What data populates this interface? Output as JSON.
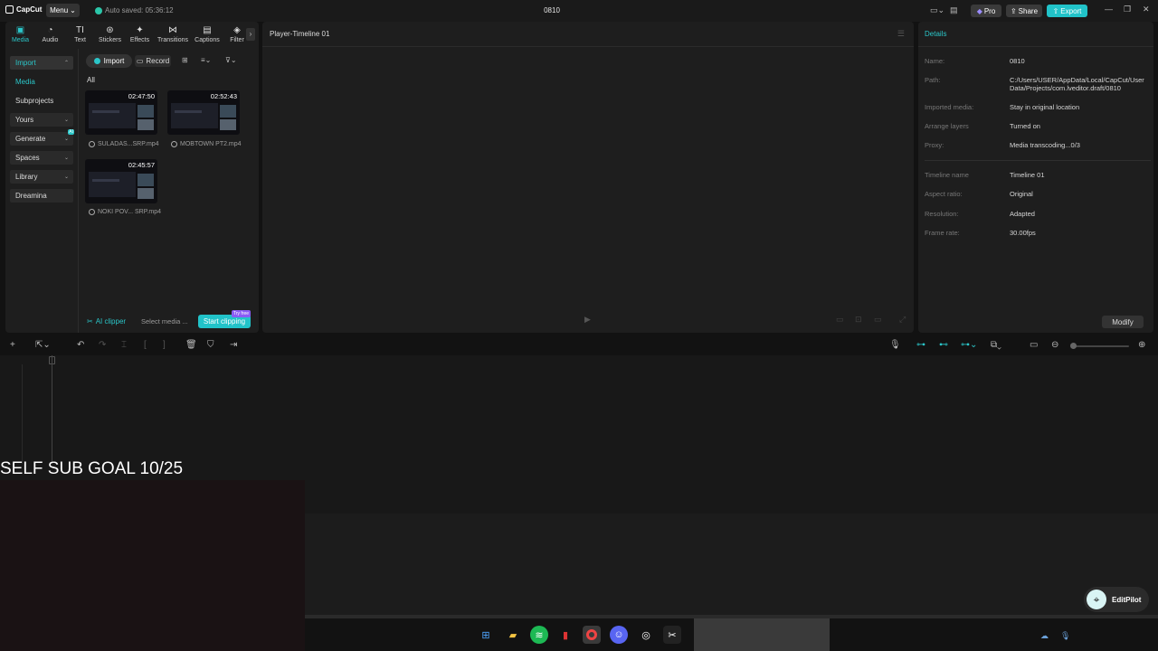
{
  "app": {
    "logo": "CapCut",
    "menu_label": "Menu",
    "autosave": "Auto saved: 05:36:12",
    "project_title": "0810",
    "pro_label": "Pro",
    "share_label": "Share",
    "export_label": "Export"
  },
  "tabs": [
    {
      "label": "Media",
      "icon": "media-icon",
      "glyph": "▣"
    },
    {
      "label": "Audio",
      "icon": "audio-icon",
      "glyph": "◔"
    },
    {
      "label": "Text",
      "icon": "text-icon",
      "glyph": "TI"
    },
    {
      "label": "Stickers",
      "icon": "stickers-icon",
      "glyph": "⊛"
    },
    {
      "label": "Effects",
      "icon": "effects-icon",
      "glyph": "✦"
    },
    {
      "label": "Transitions",
      "icon": "transitions-icon",
      "glyph": "⋈"
    },
    {
      "label": "Captions",
      "icon": "captions-icon",
      "glyph": "▤"
    },
    {
      "label": "Filter",
      "icon": "filter-icon",
      "glyph": "◈"
    }
  ],
  "sidenav": {
    "import": "Import",
    "media": "Media",
    "subprojects": "Subprojects",
    "yours": "Yours",
    "generate": "Generate",
    "generate_badge": "AI",
    "spaces": "Spaces",
    "library": "Library",
    "dreamina": "Dreamina"
  },
  "media": {
    "import_label": "Import",
    "record_label": "Record",
    "all_label": "All",
    "items": [
      {
        "duration": "02:47:50",
        "name": "SULADAS...SRP.mp4"
      },
      {
        "duration": "02:52:43",
        "name": "MOBTOWN PT2.mp4"
      },
      {
        "duration": "02:45:57",
        "name": "NOKI POV... SRP.mp4"
      }
    ]
  },
  "clipper": {
    "label": "AI clipper",
    "select_text": "Select media ...",
    "start_label": "Start clipping",
    "badge": "Try free"
  },
  "player": {
    "title": "Player-Timeline 01"
  },
  "details": {
    "title": "Details",
    "rows": [
      {
        "key": "Name:",
        "value": "0810"
      },
      {
        "key": "Path:",
        "value": "C:/Users/USER/AppData/Local/CapCut/User Data/Projects/com.lveditor.draft/0810"
      },
      {
        "key": "Imported media:",
        "value": "Stay in original location"
      },
      {
        "key": "Arrange layers",
        "value": "Turned on"
      },
      {
        "key": "Proxy:",
        "value": "Media transcoding...0/3"
      },
      {
        "key": "Timeline name",
        "value": "Timeline 01"
      },
      {
        "key": "Aspect ratio:",
        "value": "Original"
      },
      {
        "key": "Resolution:",
        "value": "Adapted"
      },
      {
        "key": "Frame rate:",
        "value": "30.00fps"
      }
    ],
    "modify_label": "Modify"
  },
  "overlay": {
    "sub_goal": "SELF SUB GOAL 10/25",
    "editpilot_label": "EditPilot"
  }
}
